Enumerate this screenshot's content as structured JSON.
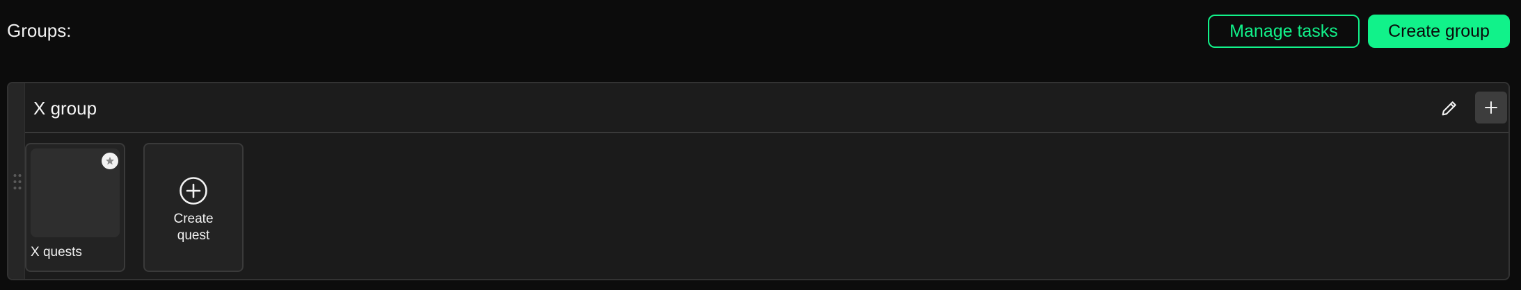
{
  "header": {
    "groups_label": "Groups:",
    "manage_tasks_label": "Manage tasks",
    "create_group_label": "Create group"
  },
  "group": {
    "title": "X group",
    "icons": {
      "drag": "drag-handle-icon",
      "edit": "pencil-icon",
      "add": "plus-icon"
    },
    "quests": [
      {
        "name": "X quests",
        "badge_icon": "star-icon"
      }
    ],
    "create_quest": {
      "line1": "Create",
      "line2": "quest",
      "icon": "plus-circle-icon"
    }
  },
  "colors": {
    "background": "#0c0c0c",
    "accent": "#11f28a",
    "panel": "#1b1b1b",
    "card": "#232323"
  }
}
